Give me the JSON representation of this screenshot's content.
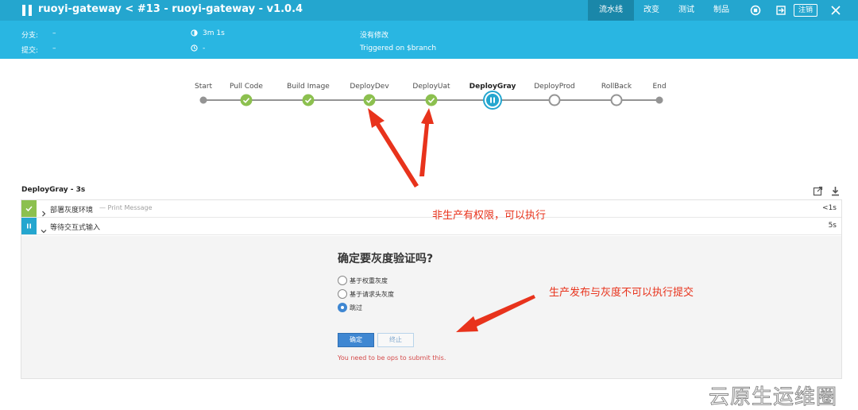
{
  "header": {
    "title": "ruoyi-gateway < #13 - ruoyi-gateway - v1.0.4",
    "tabs": [
      {
        "label": "流水线",
        "active": true
      },
      {
        "label": "改变",
        "active": false
      },
      {
        "label": "测试",
        "active": false
      },
      {
        "label": "制品",
        "active": false
      }
    ],
    "logout_label": "注销",
    "icons": [
      "pause-icon",
      "stop-icon",
      "exit-icon",
      "close-icon"
    ]
  },
  "info": {
    "branch_label": "分支:",
    "branch_value": "–",
    "commit_label": "提交:",
    "commit_value": "–",
    "duration": "3m 1s",
    "time": "-",
    "changes": "没有修改",
    "trigger": "Triggered on $branch"
  },
  "pipeline": {
    "stages": [
      {
        "label": "Start",
        "status": "start"
      },
      {
        "label": "Pull Code",
        "status": "success"
      },
      {
        "label": "Build Image",
        "status": "success"
      },
      {
        "label": "DeployDev",
        "status": "success"
      },
      {
        "label": "DeployUat",
        "status": "success"
      },
      {
        "label": "DeployGray",
        "status": "paused"
      },
      {
        "label": "DeployProd",
        "status": "not-built"
      },
      {
        "label": "RollBack",
        "status": "not-built"
      },
      {
        "label": "End",
        "status": "end"
      }
    ]
  },
  "stage_detail": {
    "title": "DeployGray - 3s",
    "steps": [
      {
        "name": "部署灰度环境",
        "sub": "— Print Message",
        "duration": "<1s",
        "status": "success"
      },
      {
        "name": "等待交互式输入",
        "sub": "",
        "duration": "5s",
        "status": "paused"
      }
    ]
  },
  "input": {
    "question": "确定要灰度验证吗?",
    "options": [
      {
        "label": "基于权重灰度",
        "checked": false
      },
      {
        "label": "基于请求头灰度",
        "checked": false
      },
      {
        "label": "跳过",
        "checked": true
      }
    ],
    "ok_label": "确定",
    "abort_label": "终止",
    "error": "You need to be ops to submit this."
  },
  "annotations": {
    "note1": "非生产有权限，可以执行",
    "note2": "生产发布与灰度不可以执行提交"
  },
  "watermark": "云原生运维圈",
  "colors": {
    "topbar": "#24a6cf",
    "infobar": "#29b6e2",
    "success": "#8cc04f",
    "paused": "#24a6cf",
    "annotation": "#e8331c"
  }
}
